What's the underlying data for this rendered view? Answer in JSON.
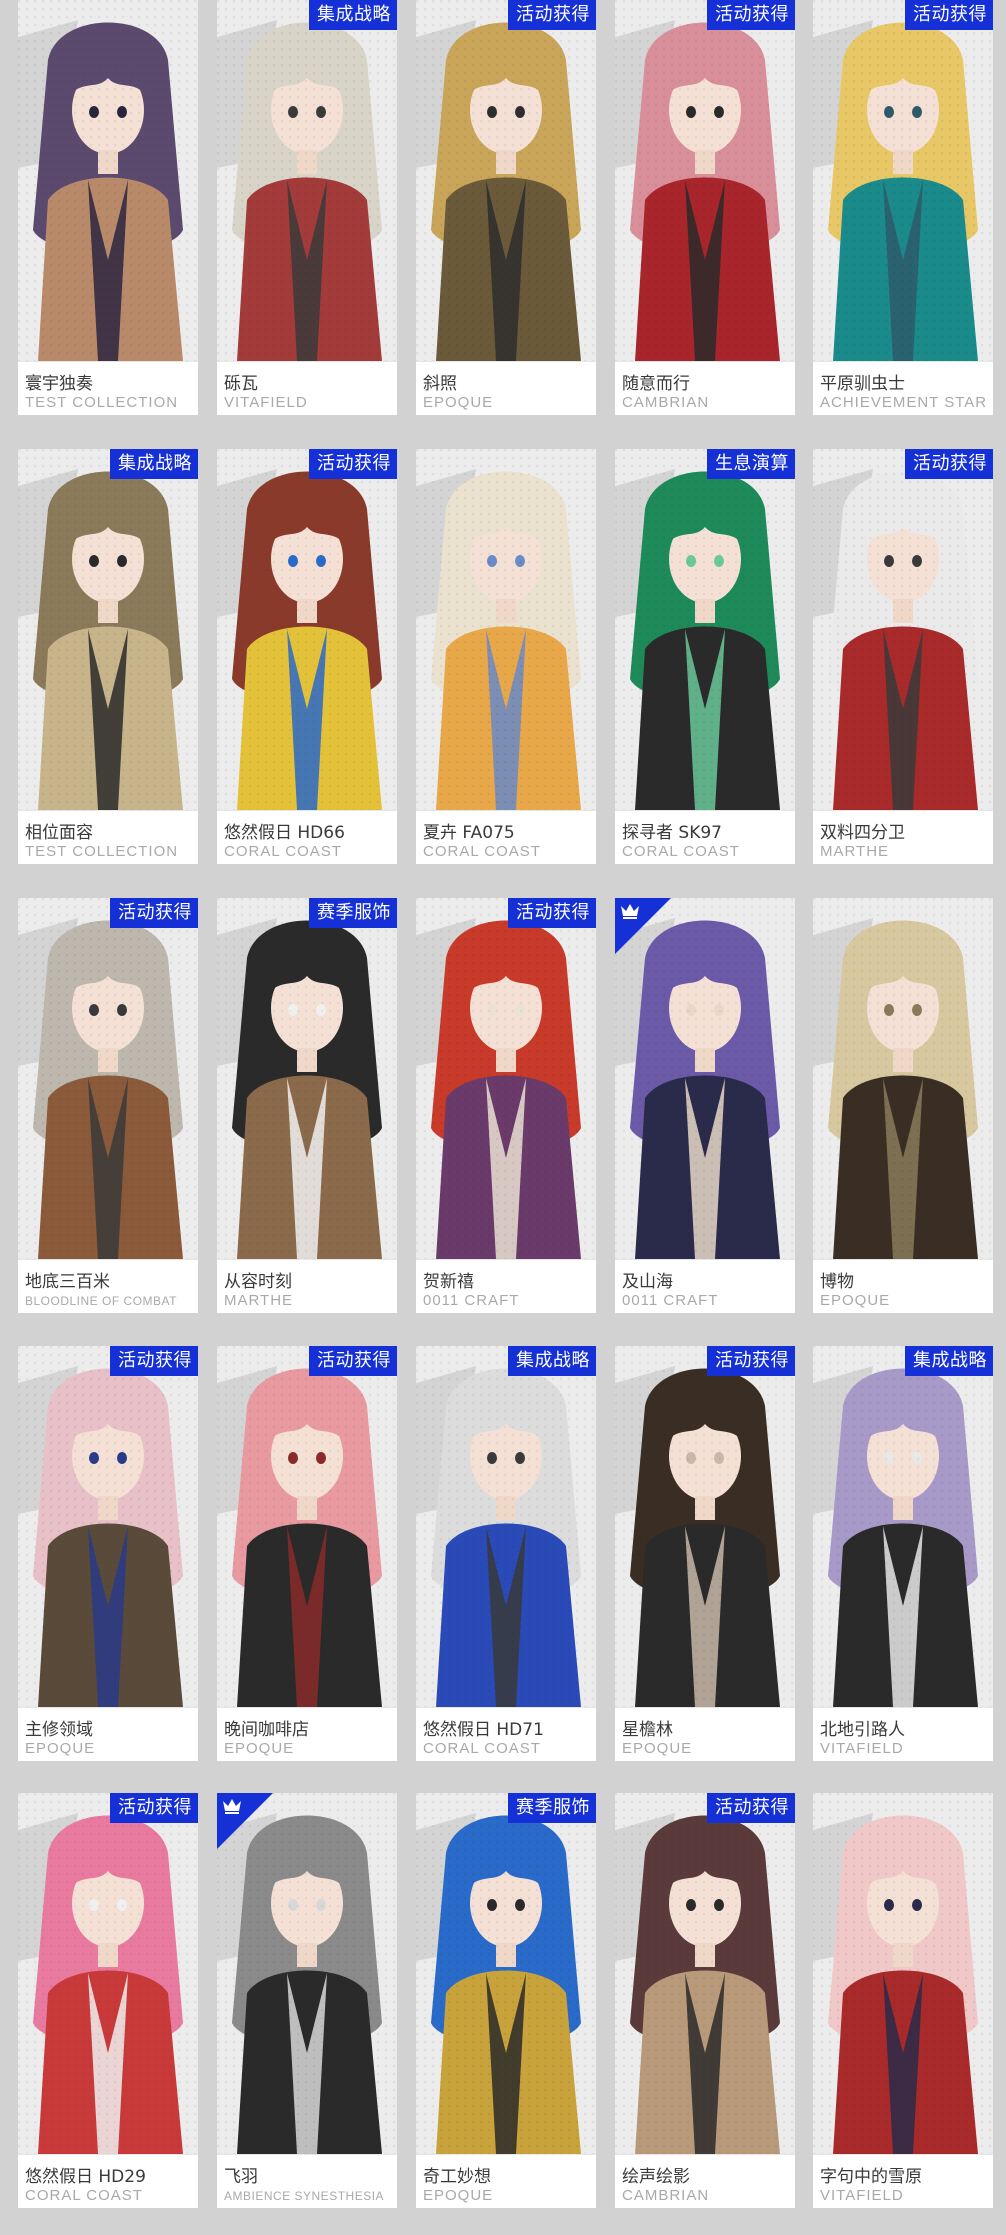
{
  "colors": {
    "page_background": "#d2d2d2",
    "tag_background": "#1430d6",
    "tag_text": "#ffffff",
    "name_text": "#3a3a3a",
    "brand_text": "#a9a9a9"
  },
  "cards": [
    {
      "name": "寰宇独奏",
      "brand": "TEST COLLECTION",
      "tag": "",
      "corner_icon": false,
      "palette": [
        "#5b4a6e",
        "#b98a6a",
        "#2a2440"
      ]
    },
    {
      "name": "砾瓦",
      "brand": "VITAFIELD",
      "tag": "集成战略",
      "corner_icon": false,
      "palette": [
        "#d9d4c8",
        "#a33b3b",
        "#3b3b3b"
      ]
    },
    {
      "name": "斜照",
      "brand": "EPOQUE",
      "tag": "活动获得",
      "corner_icon": false,
      "palette": [
        "#c9a55a",
        "#6b5a3a",
        "#2e2e2e"
      ]
    },
    {
      "name": "随意而行",
      "brand": "CAMBRIAN",
      "tag": "活动获得",
      "corner_icon": false,
      "palette": [
        "#d98f9a",
        "#a8262b",
        "#2a2a2a"
      ]
    },
    {
      "name": "平原驯虫士",
      "brand": "ACHIEVEMENT STAR",
      "tag": "活动获得",
      "corner_icon": false,
      "palette": [
        "#e8c766",
        "#1a8a8a",
        "#2e5a6a"
      ]
    },
    {
      "name": "相位面容",
      "brand": "TEST COLLECTION",
      "tag": "集成战略",
      "corner_icon": false,
      "palette": [
        "#8a7a5a",
        "#c8b48a",
        "#2a2a2a"
      ]
    },
    {
      "name": "悠然假日 HD66",
      "brand": "CORAL COAST",
      "tag": "活动获得",
      "corner_icon": false,
      "palette": [
        "#8a3a2a",
        "#e3c23a",
        "#2a6ac8"
      ]
    },
    {
      "name": "夏卉 FA075",
      "brand": "CORAL COAST",
      "tag": "",
      "corner_icon": false,
      "palette": [
        "#eae2cf",
        "#e8a84a",
        "#6a8ac8"
      ]
    },
    {
      "name": "探寻者 SK97",
      "brand": "CORAL COAST",
      "tag": "生息演算",
      "corner_icon": false,
      "palette": [
        "#1e8a5a",
        "#2a2a2a",
        "#6ac89a"
      ]
    },
    {
      "name": "双料四分卫",
      "brand": "MARTHE",
      "tag": "活动获得",
      "corner_icon": false,
      "palette": [
        "#eaeaea",
        "#a82a2a",
        "#3a3a3a"
      ]
    },
    {
      "name": "地底三百米",
      "brand": "BLOODLINE OF COMBAT",
      "tag": "活动获得",
      "corner_icon": false,
      "palette": [
        "#bdb7ad",
        "#8a5a3a",
        "#3a3a3a"
      ]
    },
    {
      "name": "从容时刻",
      "brand": "MARTHE",
      "tag": "赛季服饰",
      "corner_icon": false,
      "palette": [
        "#2a2a2a",
        "#8a6a4a",
        "#f0f0f0"
      ]
    },
    {
      "name": "贺新禧",
      "brand": "0011 CRAFT",
      "tag": "活动获得",
      "corner_icon": false,
      "palette": [
        "#c83a2a",
        "#6a3a6a",
        "#eae2d2"
      ]
    },
    {
      "name": "及山海",
      "brand": "0011 CRAFT",
      "tag": "",
      "corner_icon": true,
      "palette": [
        "#6a5aa8",
        "#2a2a4a",
        "#e8d8c8"
      ]
    },
    {
      "name": "博物",
      "brand": "EPOQUE",
      "tag": "",
      "corner_icon": false,
      "palette": [
        "#d8c8a0",
        "#3a2e24",
        "#8a7a5a"
      ]
    },
    {
      "name": "主修领域",
      "brand": "EPOQUE",
      "tag": "活动获得",
      "corner_icon": false,
      "palette": [
        "#e8c0c8",
        "#5a4a3a",
        "#2a3a8a"
      ]
    },
    {
      "name": "晚间咖啡店",
      "brand": "EPOQUE",
      "tag": "活动获得",
      "corner_icon": false,
      "palette": [
        "#e89aa0",
        "#2a2a2a",
        "#8a2a2a"
      ]
    },
    {
      "name": "悠然假日 HD71",
      "brand": "CORAL COAST",
      "tag": "集成战略",
      "corner_icon": false,
      "palette": [
        "#dcdcdc",
        "#2a4ab8",
        "#3a3a3a"
      ]
    },
    {
      "name": "星檐林",
      "brand": "EPOQUE",
      "tag": "活动获得",
      "corner_icon": false,
      "palette": [
        "#3a2e24",
        "#2a2a2a",
        "#c8b8a8"
      ]
    },
    {
      "name": "北地引路人",
      "brand": "VITAFIELD",
      "tag": "集成战略",
      "corner_icon": false,
      "palette": [
        "#a89ac8",
        "#2a2a2a",
        "#e8e8e8"
      ]
    },
    {
      "name": "悠然假日 HD29",
      "brand": "CORAL COAST",
      "tag": "活动获得",
      "corner_icon": false,
      "palette": [
        "#e87aa0",
        "#c83a3a",
        "#f0f0f0"
      ]
    },
    {
      "name": "飞羽",
      "brand": "AMBIENCE SYNESTHESIA",
      "tag": "",
      "corner_icon": true,
      "palette": [
        "#8a8a8a",
        "#2a2a2a",
        "#d8d8d8"
      ]
    },
    {
      "name": "奇工妙想",
      "brand": "EPOQUE",
      "tag": "赛季服饰",
      "corner_icon": false,
      "palette": [
        "#2a6ac8",
        "#c8a23a",
        "#2a2a2a"
      ]
    },
    {
      "name": "绘声绘影",
      "brand": "CAMBRIAN",
      "tag": "活动获得",
      "corner_icon": false,
      "palette": [
        "#5a3a3a",
        "#b89a7a",
        "#2a2a2a"
      ]
    },
    {
      "name": "字句中的雪原",
      "brand": "VITAFIELD",
      "tag": "",
      "corner_icon": false,
      "palette": [
        "#f0c8c8",
        "#a82a2a",
        "#2a2a4a"
      ]
    }
  ]
}
